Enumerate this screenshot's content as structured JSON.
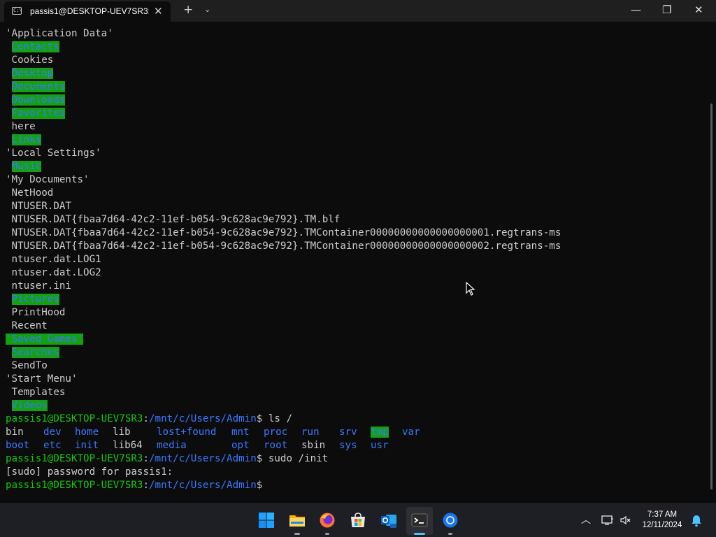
{
  "window": {
    "tab_title": "passis1@DESKTOP-UEV7SR3: ,",
    "tab_close": "✕",
    "new_tab": "+",
    "dropdown": "⌄",
    "minimize": "—",
    "maximize": "❐",
    "close": "✕"
  },
  "terminal": {
    "lines": {
      "l1": "'Application Data'",
      "l2": "Contacts",
      "l3": "Cookies",
      "l4": "Desktop",
      "l5": "Documents",
      "l6": "Downloads",
      "l7": "Favorites",
      "l8": "here",
      "l9": "Links",
      "l10": "'Local Settings'",
      "l11": "Music",
      "l12": "'My Documents'",
      "l13": "NetHood",
      "l14": "NTUSER.DAT",
      "l15": "NTUSER.DAT{fbaa7d64-42c2-11ef-b054-9c628ac9e792}.TM.blf",
      "l16": "NTUSER.DAT{fbaa7d64-42c2-11ef-b054-9c628ac9e792}.TMContainer00000000000000000001.regtrans-ms",
      "l17": "NTUSER.DAT{fbaa7d64-42c2-11ef-b054-9c628ac9e792}.TMContainer00000000000000000002.regtrans-ms",
      "l18": "ntuser.dat.LOG1",
      "l19": "ntuser.dat.LOG2",
      "l20": "ntuser.ini",
      "l21": "Pictures",
      "l22": "PrintHood",
      "l23": "Recent",
      "l24": "'Saved Games'",
      "l25": "Searches",
      "l26": "SendTo",
      "l27": "'Start Menu'",
      "l28": "Templates",
      "l29": "Videos"
    },
    "prompt_user": "passis1@DESKTOP-UEV7SR3",
    "prompt_colon": ":",
    "prompt_path": "/mnt/c/Users/Admin",
    "prompt_dollar": "$",
    "cmd1": " ls /",
    "root_dirs": {
      "bin": "bin",
      "dev": "dev",
      "home": "home",
      "lib": "lib",
      "lost_found": "lost+found",
      "mnt": "mnt",
      "proc": "proc",
      "run": "run",
      "srv": "srv",
      "tmp": "tmp",
      "var": "var",
      "boot": "boot",
      "etc": "etc",
      "init": "init",
      "lib64": "lib64",
      "media": "media",
      "opt": "opt",
      "root": "root",
      "sbin": "sbin",
      "sys": "sys",
      "usr": "usr"
    },
    "cmd2": " sudo /init",
    "sudo_prompt": "[sudo] password for passis1:"
  },
  "taskbar": {
    "time": "7:37 AM",
    "date": "12/11/2024",
    "icons": [
      "start-icon",
      "file-explorer-icon",
      "firefox-icon",
      "microsoft-store-icon",
      "outlook-new-icon",
      "terminal-icon",
      "chrome-app-icon"
    ]
  },
  "colors": {
    "bg": "#0c0c0c",
    "dir_blue": "#3b78ff",
    "highlight_green": "#13a10e",
    "prompt_green": "#16c60c",
    "text": "#cccccc"
  }
}
